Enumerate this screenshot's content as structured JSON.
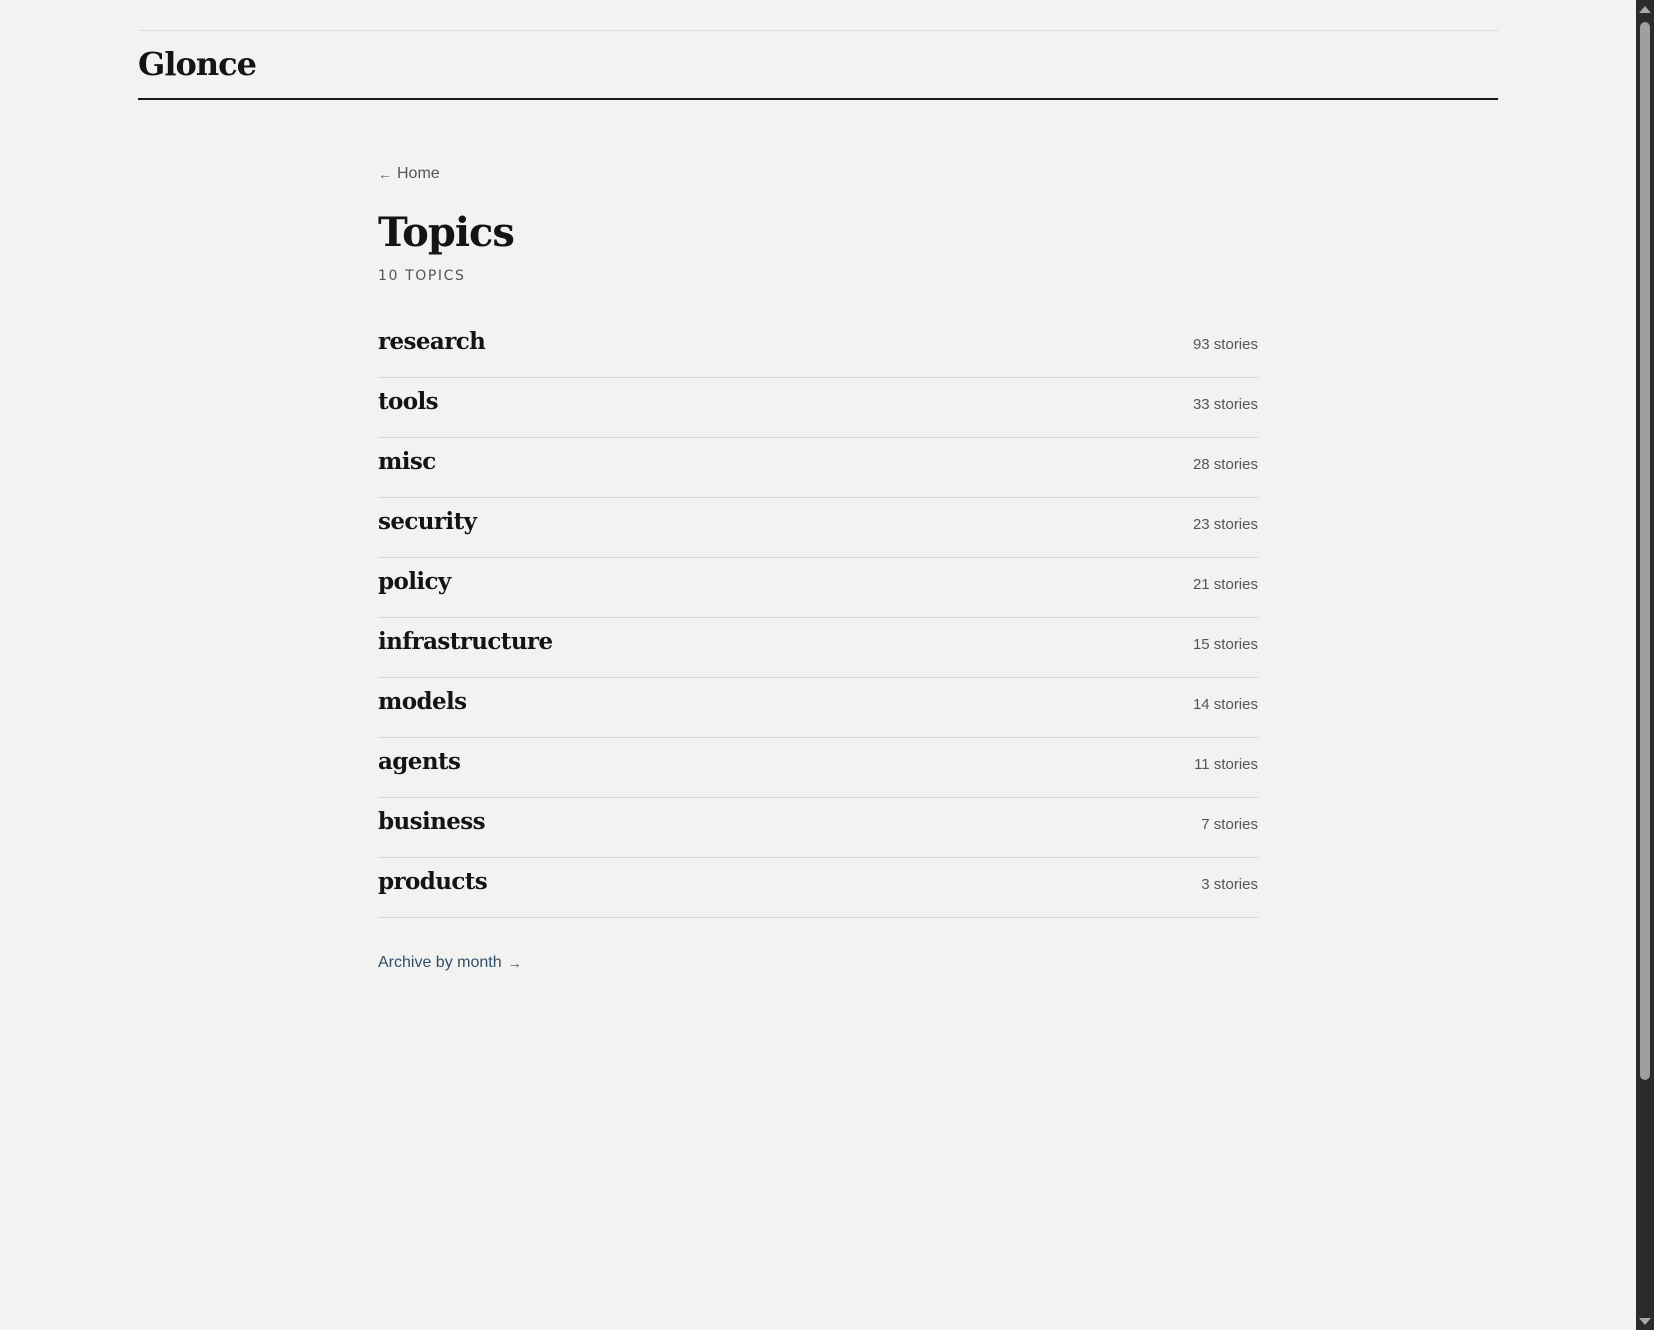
{
  "site": {
    "brand": "Glonce"
  },
  "nav": {
    "back_arrow": "←",
    "back_label": "Home"
  },
  "page": {
    "title": "Topics",
    "count_label": "10 TOPICS"
  },
  "topics": [
    {
      "name": "research",
      "stories": "93 stories"
    },
    {
      "name": "tools",
      "stories": "33 stories"
    },
    {
      "name": "misc",
      "stories": "28 stories"
    },
    {
      "name": "security",
      "stories": "23 stories"
    },
    {
      "name": "policy",
      "stories": "21 stories"
    },
    {
      "name": "infrastructure",
      "stories": "15 stories"
    },
    {
      "name": "models",
      "stories": "14 stories"
    },
    {
      "name": "agents",
      "stories": "11 stories"
    },
    {
      "name": "business",
      "stories": "7 stories"
    },
    {
      "name": "products",
      "stories": "3 stories"
    }
  ],
  "footer_nav": {
    "archive_label": "Archive by month",
    "archive_arrow": "→"
  },
  "theme": {
    "background": "#f2f2f1",
    "text": "#141414",
    "muted": "#555555",
    "link": "#2e4f6b",
    "divider": "#d8d8d6"
  },
  "icons": {
    "back": "left-arrow-icon",
    "archive": "right-arrow-icon",
    "scroll_up": "scroll-up-arrow-icon",
    "scroll_down": "scroll-down-arrow-icon"
  }
}
